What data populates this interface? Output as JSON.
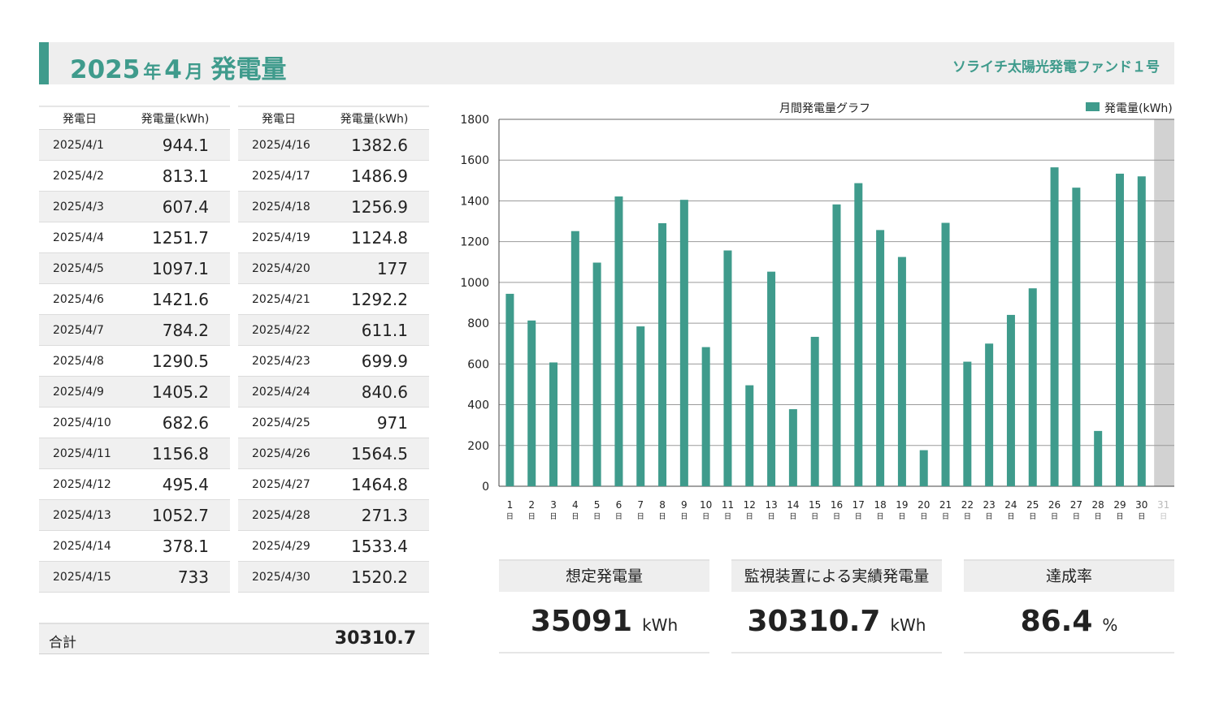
{
  "header": {
    "year": "2025",
    "year_suffix": "年",
    "month": "4",
    "month_suffix": "月",
    "title": "発電量",
    "fund_name": "ソライチ太陽光発電ファンド１号"
  },
  "table": {
    "col_date": "発電日",
    "col_value": "発電量(kWh)",
    "rows": [
      {
        "date": "2025/4/1",
        "value": "944.1"
      },
      {
        "date": "2025/4/2",
        "value": "813.1"
      },
      {
        "date": "2025/4/3",
        "value": "607.4"
      },
      {
        "date": "2025/4/4",
        "value": "1251.7"
      },
      {
        "date": "2025/4/5",
        "value": "1097.1"
      },
      {
        "date": "2025/4/6",
        "value": "1421.6"
      },
      {
        "date": "2025/4/7",
        "value": "784.2"
      },
      {
        "date": "2025/4/8",
        "value": "1290.5"
      },
      {
        "date": "2025/4/9",
        "value": "1405.2"
      },
      {
        "date": "2025/4/10",
        "value": "682.6"
      },
      {
        "date": "2025/4/11",
        "value": "1156.8"
      },
      {
        "date": "2025/4/12",
        "value": "495.4"
      },
      {
        "date": "2025/4/13",
        "value": "1052.7"
      },
      {
        "date": "2025/4/14",
        "value": "378.1"
      },
      {
        "date": "2025/4/15",
        "value": "733"
      },
      {
        "date": "2025/4/16",
        "value": "1382.6"
      },
      {
        "date": "2025/4/17",
        "value": "1486.9"
      },
      {
        "date": "2025/4/18",
        "value": "1256.9"
      },
      {
        "date": "2025/4/19",
        "value": "1124.8"
      },
      {
        "date": "2025/4/20",
        "value": "177"
      },
      {
        "date": "2025/4/21",
        "value": "1292.2"
      },
      {
        "date": "2025/4/22",
        "value": "611.1"
      },
      {
        "date": "2025/4/23",
        "value": "699.9"
      },
      {
        "date": "2025/4/24",
        "value": "840.6"
      },
      {
        "date": "2025/4/25",
        "value": "971"
      },
      {
        "date": "2025/4/26",
        "value": "1564.5"
      },
      {
        "date": "2025/4/27",
        "value": "1464.8"
      },
      {
        "date": "2025/4/28",
        "value": "271.3"
      },
      {
        "date": "2025/4/29",
        "value": "1533.4"
      },
      {
        "date": "2025/4/30",
        "value": "1520.2"
      }
    ]
  },
  "total": {
    "label": "合計",
    "value": "30310.7"
  },
  "kpis": [
    {
      "label": "想定発電量",
      "value": "35091",
      "unit": "kWh"
    },
    {
      "label": "監視装置による実績発電量",
      "value": "30310.7",
      "unit": "kWh"
    },
    {
      "label": "達成率",
      "value": "86.4",
      "unit": "%"
    }
  ],
  "colors": {
    "accent": "#3f9b8c",
    "bar": "#3f9b8c",
    "inactive_day": "#d2d2d2"
  },
  "chart_data": {
    "type": "bar",
    "title": "月間発電量グラフ",
    "categories": [
      "1",
      "2",
      "3",
      "4",
      "5",
      "6",
      "7",
      "8",
      "9",
      "10",
      "11",
      "12",
      "13",
      "14",
      "15",
      "16",
      "17",
      "18",
      "19",
      "20",
      "21",
      "22",
      "23",
      "24",
      "25",
      "26",
      "27",
      "28",
      "29",
      "30",
      "31"
    ],
    "category_suffix": "日",
    "series": [
      {
        "name": "発電量(kWh)",
        "values": [
          944.1,
          813.1,
          607.4,
          1251.7,
          1097.1,
          1421.6,
          784.2,
          1290.5,
          1405.2,
          682.6,
          1156.8,
          495.4,
          1052.7,
          378.1,
          733,
          1382.6,
          1486.9,
          1256.9,
          1124.8,
          177,
          1292.2,
          611.1,
          699.9,
          840.6,
          971,
          1564.5,
          1464.8,
          271.3,
          1533.4,
          1520.2,
          null
        ]
      }
    ],
    "inactive_categories": [
      "31"
    ],
    "ylim": [
      0,
      1800
    ],
    "yticks": [
      0,
      200,
      400,
      600,
      800,
      1000,
      1200,
      1400,
      1600,
      1800
    ],
    "grid": true,
    "legend_position": "top-right"
  }
}
